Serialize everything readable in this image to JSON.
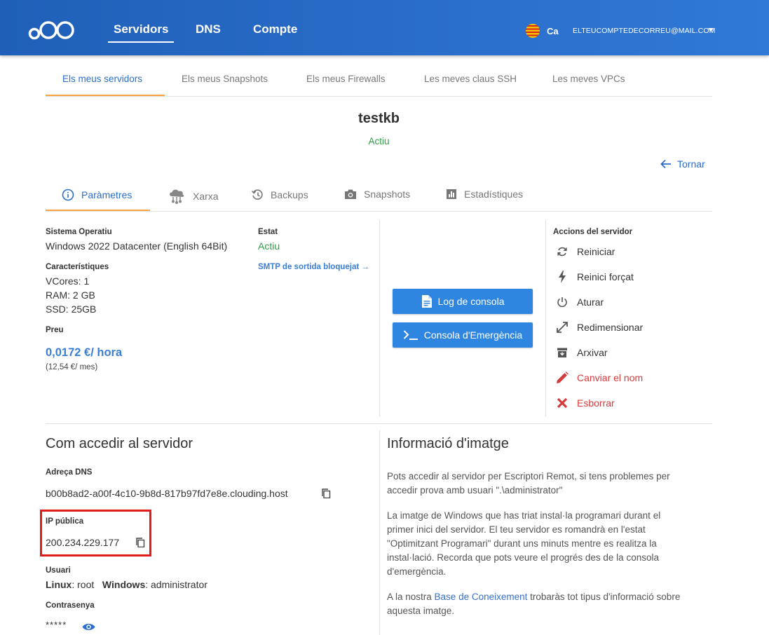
{
  "nav": {
    "items": [
      {
        "label": "Servidors"
      },
      {
        "label": "DNS"
      },
      {
        "label": "Compte"
      }
    ],
    "lang": "Ca",
    "account": "ELTEUCOMPTEDECORREU@MAIL.COM"
  },
  "subtabs": [
    {
      "label": "Els meus servidors"
    },
    {
      "label": "Els meus Snapshots"
    },
    {
      "label": "Els meus Firewalls"
    },
    {
      "label": "Les meves claus SSH"
    },
    {
      "label": "Les meves VPCs"
    }
  ],
  "server": {
    "name": "testkb",
    "status": "Actiu"
  },
  "back_label": "Tornar",
  "tabs": [
    {
      "label": "Paràmetres",
      "icon": "info-icon"
    },
    {
      "label": "Xarxa",
      "icon": "network-icon"
    },
    {
      "label": "Backups",
      "icon": "history-icon"
    },
    {
      "label": "Snapshots",
      "icon": "camera-icon"
    },
    {
      "label": "Estadístiques",
      "icon": "chart-icon"
    }
  ],
  "params": {
    "os_label": "Sistema Operatiu",
    "os_value": "Windows 2022 Datacenter (English 64Bit)",
    "features_label": "Característiques",
    "vcores": "VCores: 1",
    "ram": "RAM: 2 GB",
    "ssd": "SSD: 25GB",
    "price_label": "Preu",
    "price_hour": "0,0172 €/ hora",
    "price_month": "(12,54 €/ mes)",
    "state_label": "Estat",
    "state_value": "Actiu",
    "smtp_link": "SMTP de sortida bloquejat →"
  },
  "buttons": {
    "console_log": "Log de consola",
    "emergency_console": "Consola d'Emergència"
  },
  "actions": {
    "title": "Accions del servidor",
    "items": [
      {
        "label": "Reiniciar",
        "icon": "restart-icon"
      },
      {
        "label": "Reinici forçat",
        "icon": "bolt-icon"
      },
      {
        "label": "Aturar",
        "icon": "power-icon"
      },
      {
        "label": "Redimensionar",
        "icon": "resize-icon"
      },
      {
        "label": "Arxivar",
        "icon": "archive-icon"
      },
      {
        "label": "Canviar el nom",
        "icon": "pencil-icon"
      },
      {
        "label": "Esborrar",
        "icon": "delete-icon"
      }
    ]
  },
  "access": {
    "title": "Com accedir al servidor",
    "dns_label": "Adreça DNS",
    "dns_value": "b00b8ad2-a00f-4c10-9b8d-817b97fd7e8e.clouding.host",
    "ip_label": "IP pública",
    "ip_value": "200.234.229.177",
    "user_label": "Usuari",
    "linux_label": "Linux",
    "linux_value": ": root",
    "windows_label": "Windows",
    "windows_value": ": administrator",
    "password_label": "Contrasenya",
    "password_value": "*****"
  },
  "image_info": {
    "title": "Informació d'imatge",
    "p1_line1": "Pots accedir al servidor per Escriptori Remot, si tens problemes per",
    "p1_line2": "accedir prova amb usuari \".\\administrator\"",
    "p2_line1": "La imatge de Windows que has triat instal·la programari durant el",
    "p2_line2": "primer inici del servidor. El teu servidor es romandrà en l'estat",
    "p2_line3": "\"Optimitzant Programari\" durant uns minuts mentre es realitza la",
    "p2_line4": "instal·lació. Recorda que pots veure el progrés des de la consola",
    "p2_line5": "d'emergència.",
    "p3_before": "A la nostra ",
    "p3_link": "Base de Coneixement",
    "p3_after": " trobaràs tot tipus d'informació sobre",
    "p3_line2": "aquesta imatge."
  },
  "colors": {
    "primary": "#2a6fcb",
    "accent_orange": "#f5a440",
    "status_green": "#2e9e46",
    "danger_red": "#d63b3b",
    "highlight_red": "#e21b1b"
  }
}
